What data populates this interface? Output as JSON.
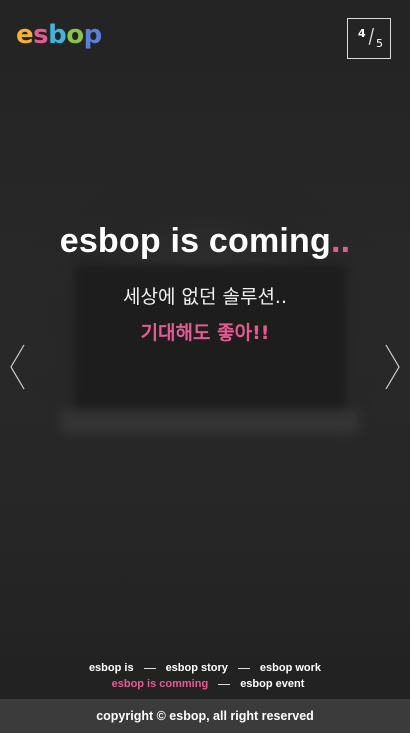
{
  "brand": {
    "logo_letters": [
      "e",
      "s",
      "b",
      "o",
      "p"
    ],
    "logo_colors": [
      "#f2b233",
      "#e65a93",
      "#43b3d9",
      "#8bc34a",
      "#5b7fd6"
    ]
  },
  "pager": {
    "current": "4",
    "total": "5"
  },
  "hero": {
    "headline": "esbop is coming",
    "headline_dots": "..",
    "subtitle": "세상에 없던 솔루션..",
    "accent": "기대해도 좋아!!"
  },
  "icons": {
    "prev": "chevron-left-icon",
    "next": "chevron-right-icon"
  },
  "footer": {
    "nav_row1": [
      "esbop is",
      "esbop story",
      "esbop work"
    ],
    "nav_row2": [
      "esbop is comming",
      "esbop event"
    ],
    "active": "esbop is comming",
    "copyright": "copyright © esbop, all right reserved"
  },
  "colors": {
    "accent": "#e65a93",
    "background": "#262626",
    "footer_bar": "#3b3b3b"
  }
}
